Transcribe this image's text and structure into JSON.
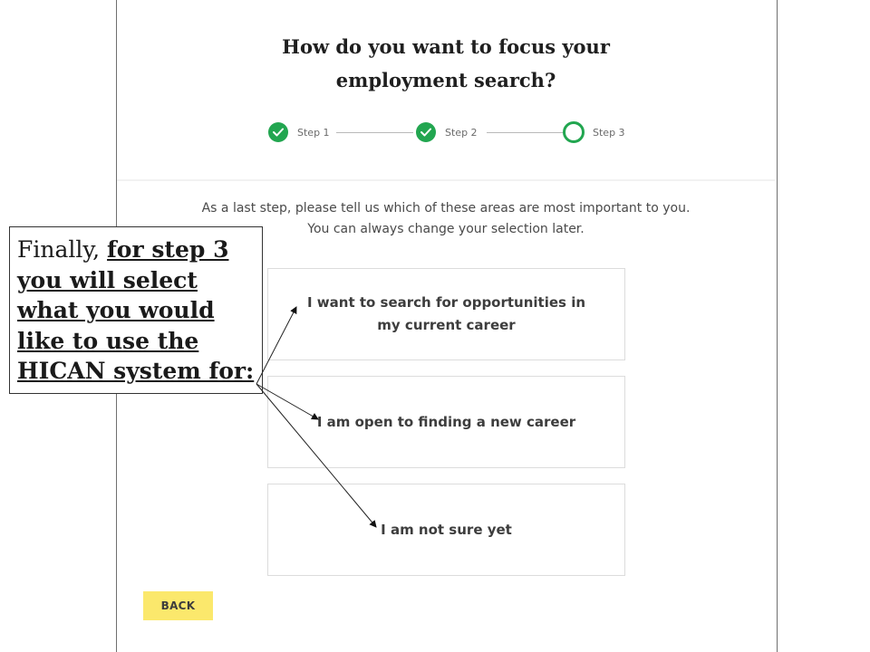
{
  "header": {
    "title_line1": "How do you want to focus your",
    "title_line2": "employment search?"
  },
  "stepper": {
    "steps": [
      {
        "label": "Step 1",
        "status": "complete"
      },
      {
        "label": "Step 2",
        "status": "complete"
      },
      {
        "label": "Step 3",
        "status": "current"
      }
    ],
    "accent_color": "#22a650"
  },
  "instructions": {
    "line1": "As a last step, please tell us which of these areas are most important to you.",
    "line2": "You can always change your selection later."
  },
  "options": [
    {
      "label": "I want to search for opportunities in my current career"
    },
    {
      "label": "I am open to finding a new career"
    },
    {
      "label": "I am not sure yet"
    }
  ],
  "footer": {
    "back_label": "BACK",
    "back_color": "#fbe86c"
  },
  "callout": {
    "plain_text": "Finally, ",
    "emphasis_text": "for step 3 you will select what you would like to use the HICAN system for:"
  }
}
